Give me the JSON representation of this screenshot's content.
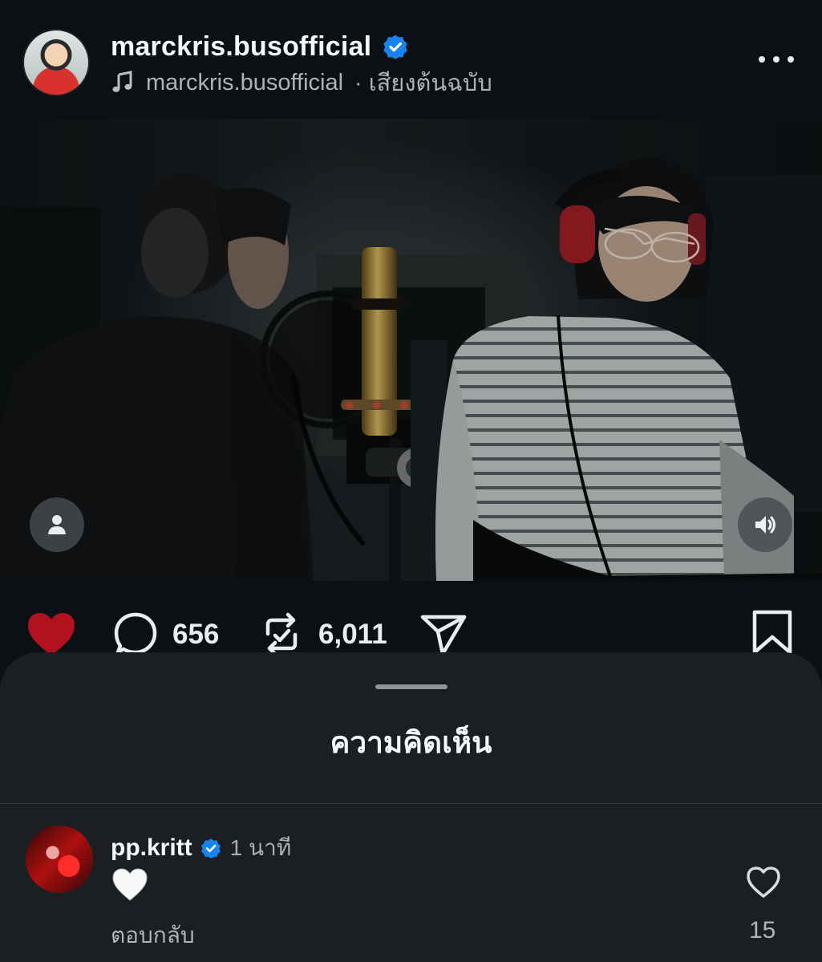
{
  "post": {
    "username": "marckris.busofficial",
    "audio_owner": "marckris.busofficial",
    "audio_label": "· เสียงต้นฉบับ",
    "icons": {
      "verified": "verified-badge-icon",
      "audio": "music-note-icon",
      "more": "more-options-icon",
      "user_tag": "user-icon",
      "sound": "speaker-icon"
    },
    "colors": {
      "liked": "#b1121d",
      "verified": "#1683f0"
    }
  },
  "actions": {
    "like_icon": "heart-icon",
    "comments_count": "656",
    "comments_icon": "comment-icon",
    "reposts_count": "6,011",
    "repost_icon": "repost-icon",
    "share_icon": "send-icon",
    "save_icon": "bookmark-icon"
  },
  "comments_sheet": {
    "title": "ความคิดเห็น",
    "comment": {
      "username": "pp.kritt",
      "time": "1 นาที",
      "text_emoji": "white-heart-emoji",
      "reply_label": "ตอบกลับ",
      "likes": "15",
      "like_icon": "heart-outline-icon"
    }
  }
}
